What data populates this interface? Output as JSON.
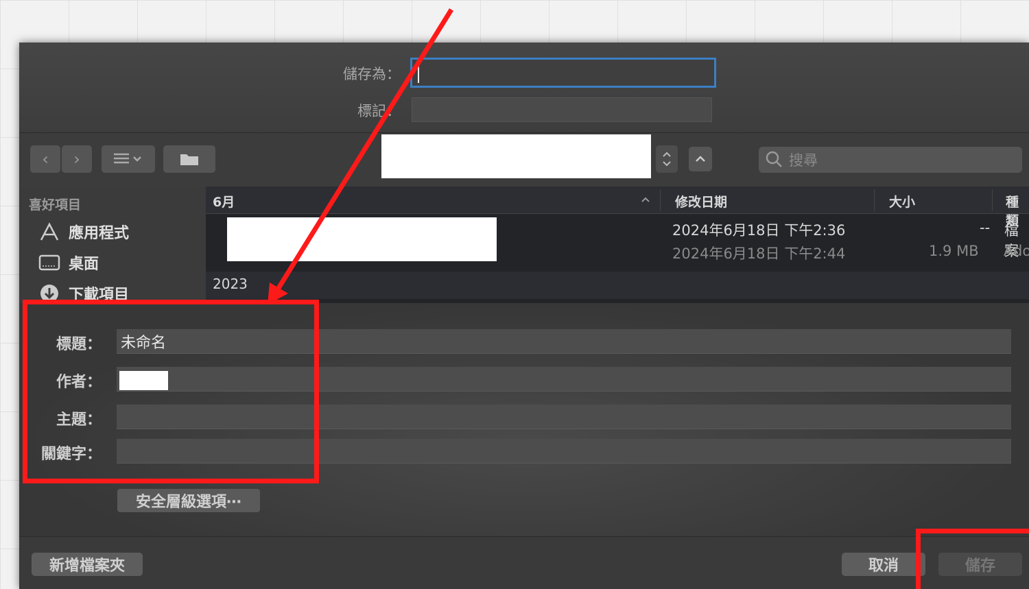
{
  "save_as": {
    "label": "儲存為：",
    "value": ""
  },
  "tags": {
    "label": "標記：",
    "value": ""
  },
  "toolbar": {
    "back_icon": "chevron-left",
    "forward_icon": "chevron-right",
    "view_icon": "list-view",
    "folder_icon": "new-folder",
    "expand_icon": "chevron-up",
    "search_placeholder": "搜尋"
  },
  "sidebar": {
    "heading": "喜好項目",
    "items": [
      {
        "label": "應用程式",
        "icon": "applications-icon"
      },
      {
        "label": "桌面",
        "icon": "desktop-icon"
      },
      {
        "label": "下載項目",
        "icon": "downloads-icon"
      }
    ]
  },
  "file_list": {
    "columns": [
      "6月",
      "修改日期",
      "大小",
      "種類"
    ],
    "rows": [
      {
        "date": "2024年6月18日 下午2:36",
        "size": "--",
        "kind": "檔案"
      },
      {
        "date": "2024年6月18日 下午2:44",
        "size": "1.9 MB",
        "kind": "Ado"
      }
    ],
    "group_label": "2023"
  },
  "metadata": {
    "title_label": "標題：",
    "title_value": "未命名",
    "author_label": "作者：",
    "subject_label": "主題：",
    "keywords_label": "關鍵字："
  },
  "security_button": "安全層級選項⋯",
  "buttons": {
    "new_folder": "新增檔案夾",
    "cancel": "取消",
    "save": "儲存"
  },
  "annotation_color": "#ff1a1a"
}
